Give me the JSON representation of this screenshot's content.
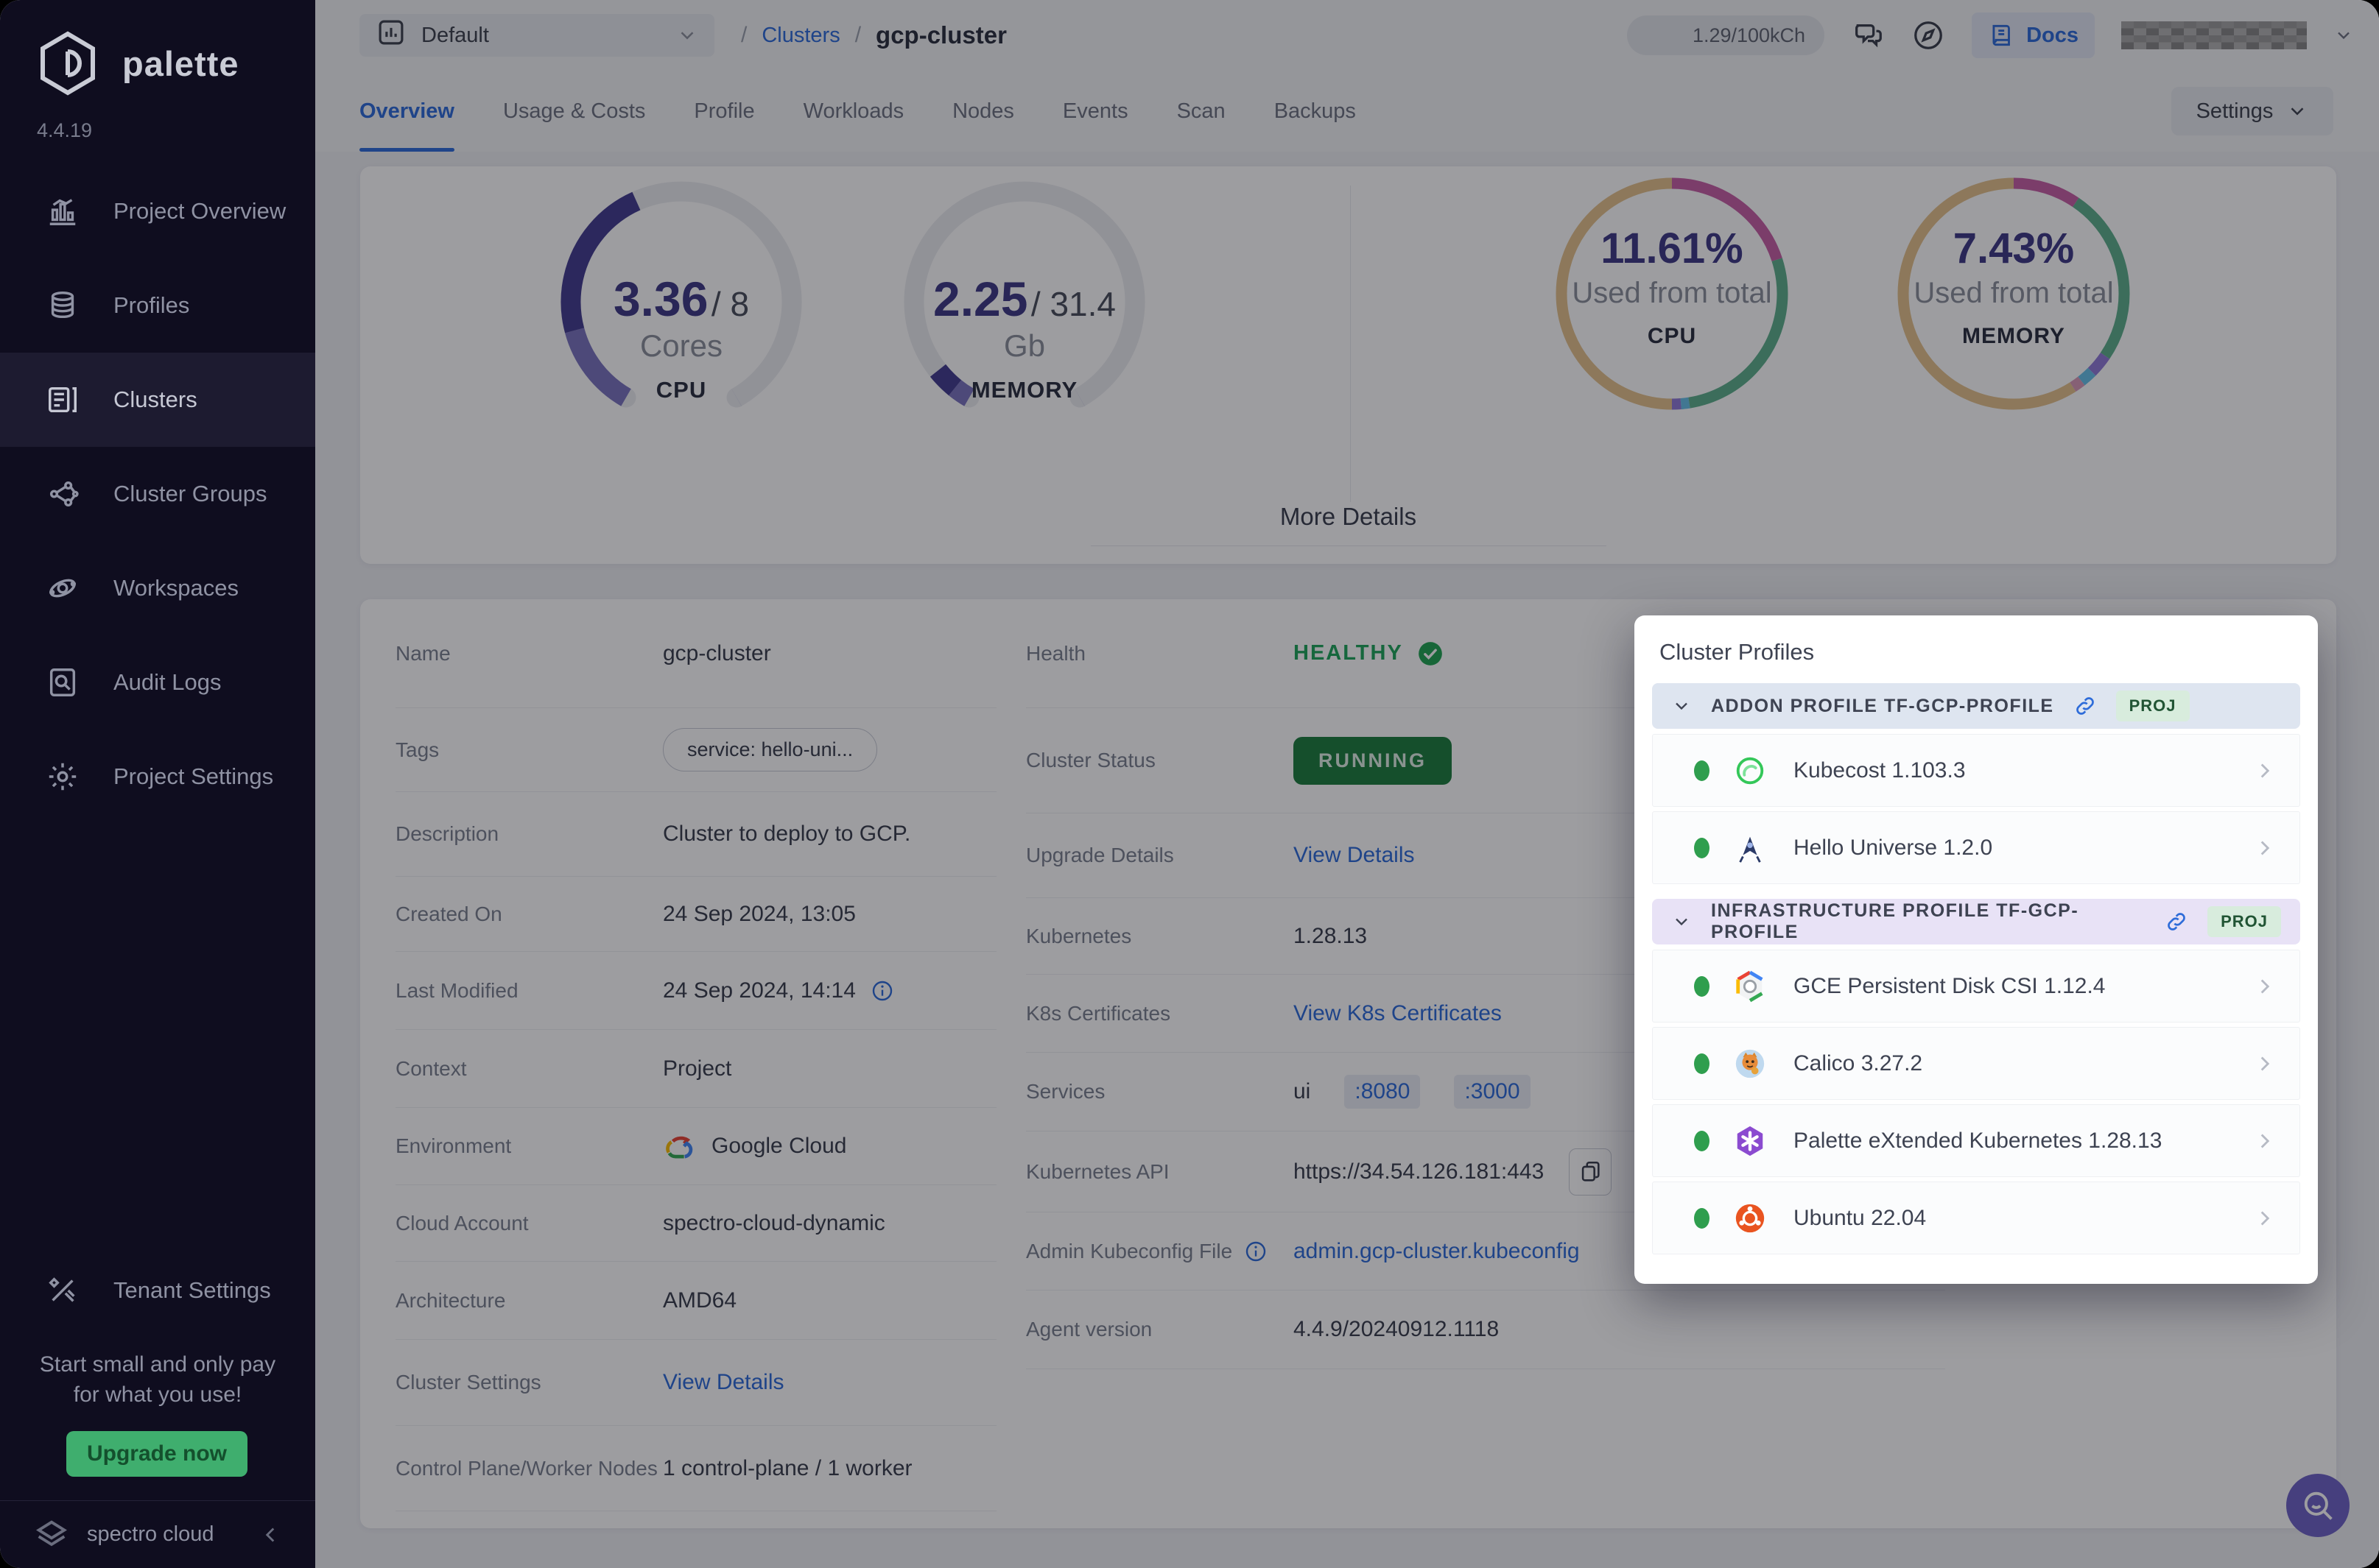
{
  "sidebar": {
    "brand": "palette",
    "version": "4.4.19",
    "items": [
      {
        "label": "Project Overview",
        "icon": "project-overview-icon",
        "active": false
      },
      {
        "label": "Profiles",
        "icon": "profiles-icon",
        "active": false
      },
      {
        "label": "Clusters",
        "icon": "clusters-icon",
        "active": true
      },
      {
        "label": "Cluster Groups",
        "icon": "cluster-groups-icon",
        "active": false
      },
      {
        "label": "Workspaces",
        "icon": "workspaces-icon",
        "active": false
      },
      {
        "label": "Audit Logs",
        "icon": "audit-logs-icon",
        "active": false
      },
      {
        "label": "Project Settings",
        "icon": "project-settings-icon",
        "active": false
      }
    ],
    "tenant_item": {
      "label": "Tenant Settings",
      "icon": "tenant-settings-icon"
    },
    "promo_line1": "Start small and only pay",
    "promo_line2": "for what you use!",
    "upgrade_label": "Upgrade now",
    "footer_brand": "spectro cloud"
  },
  "topbar": {
    "project_selector": "Default",
    "breadcrumb": {
      "separator": "/",
      "link": "Clusters",
      "current": "gcp-cluster"
    },
    "usage_pill": "1.29/100kCh",
    "docs_label": "Docs"
  },
  "tabs": {
    "items": [
      "Overview",
      "Usage & Costs",
      "Profile",
      "Workloads",
      "Nodes",
      "Events",
      "Scan",
      "Backups"
    ],
    "active_index": 0,
    "settings_label": "Settings"
  },
  "metrics": {
    "cpu_gauge": {
      "used": "3.36",
      "sep": "/",
      "total": "8",
      "unit": "Cores",
      "label": "CPU",
      "segments": [
        {
          "color": "#7a73bf",
          "value": 15
        },
        {
          "color": "#433d8f",
          "value": 27
        }
      ]
    },
    "memory_gauge": {
      "used": "2.25",
      "sep": "/",
      "total": "31.4",
      "unit": "Gb",
      "label": "MEMORY",
      "segments": [
        {
          "color": "#7a73bf",
          "value": 3
        },
        {
          "color": "#433d8f",
          "value": 4.2
        }
      ]
    },
    "cpu_donut": {
      "percent": "11.61%",
      "caption": "Used from total",
      "label": "CPU",
      "segments": [
        {
          "color": "#c75fa6",
          "value": 20
        },
        {
          "color": "#5eb08c",
          "value": 27.5
        },
        {
          "color": "#66c0e8",
          "value": 1.2
        },
        {
          "color": "#8f7bd8",
          "value": 1.3
        },
        {
          "color": "#e4c28c",
          "value": 50
        }
      ]
    },
    "memory_donut": {
      "percent": "7.43%",
      "caption": "Used from total",
      "label": "MEMORY",
      "segments": [
        {
          "color": "#c75fa6",
          "value": 9.5
        },
        {
          "color": "#5eb08c",
          "value": 25
        },
        {
          "color": "#8f7bd8",
          "value": 3
        },
        {
          "color": "#66c0e8",
          "value": 2
        },
        {
          "color": "#d99ab8",
          "value": 1.5
        },
        {
          "color": "#e4c28c",
          "value": 59
        }
      ]
    }
  },
  "more_details_label": "More Details",
  "details": {
    "left_rows": [
      {
        "label": "Name",
        "type": "text",
        "value": "gcp-cluster"
      },
      {
        "label": "Tags",
        "type": "tag",
        "value": "service: hello-uni..."
      },
      {
        "label": "Description",
        "type": "text",
        "value": "Cluster to deploy to GCP."
      },
      {
        "label": "Created On",
        "type": "text",
        "value": "24 Sep 2024, 13:05"
      },
      {
        "label": "Last Modified",
        "type": "text_info",
        "value": "24 Sep 2024, 14:14"
      },
      {
        "label": "Context",
        "type": "text",
        "value": "Project"
      },
      {
        "label": "Environment",
        "type": "env",
        "value": "Google Cloud"
      },
      {
        "label": "Cloud Account",
        "type": "text",
        "value": "spectro-cloud-dynamic"
      },
      {
        "label": "Architecture",
        "type": "text",
        "value": "AMD64"
      },
      {
        "label": "Cluster Settings",
        "type": "link",
        "value": "View Details"
      },
      {
        "label": "Control Plane/Worker Nodes",
        "type": "text",
        "value": "1 control-plane / 1 worker"
      }
    ],
    "right_rows": [
      {
        "label": "Health",
        "type": "health",
        "value": "HEALTHY"
      },
      {
        "label": "Cluster Status",
        "type": "badge",
        "value": "RUNNING"
      },
      {
        "label": "Upgrade Details",
        "type": "link",
        "value": "View Details"
      },
      {
        "label": "Kubernetes",
        "type": "text",
        "value": "1.28.13"
      },
      {
        "label": "K8s Certificates",
        "type": "link",
        "value": "View K8s Certificates"
      },
      {
        "label": "Services",
        "type": "services",
        "prefix": "ui",
        "ports": [
          ":8080",
          ":3000"
        ]
      },
      {
        "label": "Kubernetes API",
        "type": "api",
        "value": "https://34.54.126.181:443"
      },
      {
        "label": "Admin Kubeconfig File",
        "label_info": true,
        "type": "link",
        "value": "admin.gcp-cluster.kubeconfig"
      },
      {
        "label": "Agent version",
        "type": "text",
        "value": "4.4.9/20240912.1118"
      }
    ]
  },
  "profiles_panel": {
    "title": "Cluster Profiles",
    "sections": [
      {
        "name": "ADDON PROFILE TF-GCP-PROFILE",
        "badge": "PROJ",
        "theme": "blue",
        "items": [
          {
            "name": "Kubecost 1.103.3",
            "icon": "kubecost-logo"
          },
          {
            "name": "Hello Universe 1.2.0",
            "icon": "hello-universe-logo"
          }
        ]
      },
      {
        "name": "INFRASTRUCTURE PROFILE TF-GCP-PROFILE",
        "badge": "PROJ",
        "theme": "purple",
        "items": [
          {
            "name": "GCE Persistent Disk CSI 1.12.4",
            "icon": "gce-disk-logo"
          },
          {
            "name": "Calico 3.27.2",
            "icon": "calico-logo"
          },
          {
            "name": "Palette eXtended Kubernetes 1.28.13",
            "icon": "pxk-logo"
          },
          {
            "name": "Ubuntu 22.04",
            "icon": "ubuntu-logo"
          }
        ]
      }
    ]
  },
  "colors": {
    "accent_blue": "#2e6cd9",
    "healthy_green": "#1ea65a",
    "running_bg": "#1d7d3f",
    "upgrade_green": "#3fae6e",
    "fab_purple": "#6f63c6",
    "gauge_indigo": "#433d8f"
  }
}
